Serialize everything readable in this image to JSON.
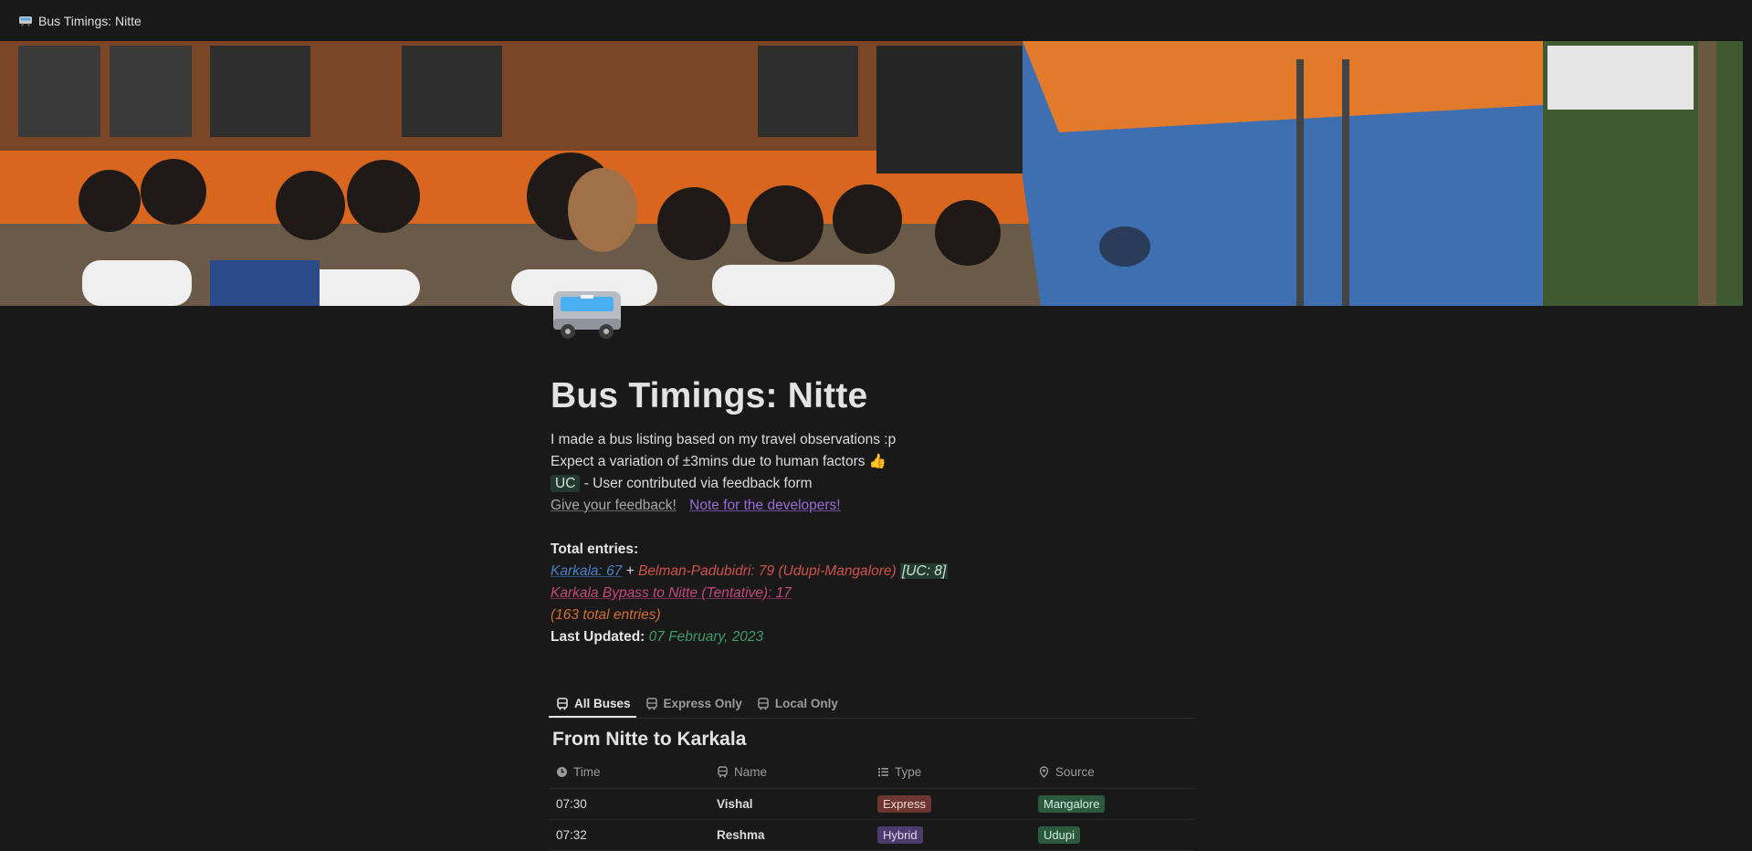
{
  "window": {
    "title": "Bus Timings: Nitte",
    "icon": "bus-icon"
  },
  "page": {
    "icon": "bus-emoji-icon",
    "title": "Bus Timings: Nitte",
    "intro_line1": "I made a bus listing based on my travel observations :p",
    "intro_line2": "Expect a variation of ±3mins due to human factors 👍",
    "uc_tag": "UC",
    "uc_desc": " - User contributed via feedback form",
    "feedback_link": "Give your feedback!",
    "dev_note_link": "Note for the developers!",
    "total_label": "Total entries:",
    "karkala_count": "Karkala: 67",
    "plus": " + ",
    "belman_count": "Belman-Padubidri: 79 (Udupi-Mangalore)",
    "uc_count": "[UC: 8]",
    "bypass_count": "Karkala Bypass to Nitte (Tentative): 17",
    "total_entries": "(163 total entries)",
    "last_updated_label": "Last Updated:",
    "last_updated_value": "07 February, 2023"
  },
  "tabs": [
    {
      "label": "All Buses",
      "active": true,
      "icon": "bus-icon"
    },
    {
      "label": "Express Only",
      "active": false,
      "icon": "bus-icon"
    },
    {
      "label": "Local Only",
      "active": false,
      "icon": "bus-icon"
    }
  ],
  "section_title": "From Nitte to Karkala",
  "table": {
    "columns": [
      {
        "label": "Time",
        "icon": "clock-icon"
      },
      {
        "label": "Name",
        "icon": "bus-icon"
      },
      {
        "label": "Type",
        "icon": "list-icon"
      },
      {
        "label": "Source",
        "icon": "location-pin-icon"
      }
    ],
    "rows": [
      {
        "time": "07:30",
        "name": "Vishal",
        "type": "Express",
        "source": "Mangalore"
      },
      {
        "time": "07:32",
        "name": "Reshma",
        "type": "Hybrid",
        "source": "Udupi"
      }
    ]
  },
  "colors": {
    "background": "#191919",
    "express_tag": "#6e3630",
    "hybrid_tag": "#4b3b6e",
    "source_tag": "#2b5a3f",
    "uc_tag": "#24392f"
  }
}
